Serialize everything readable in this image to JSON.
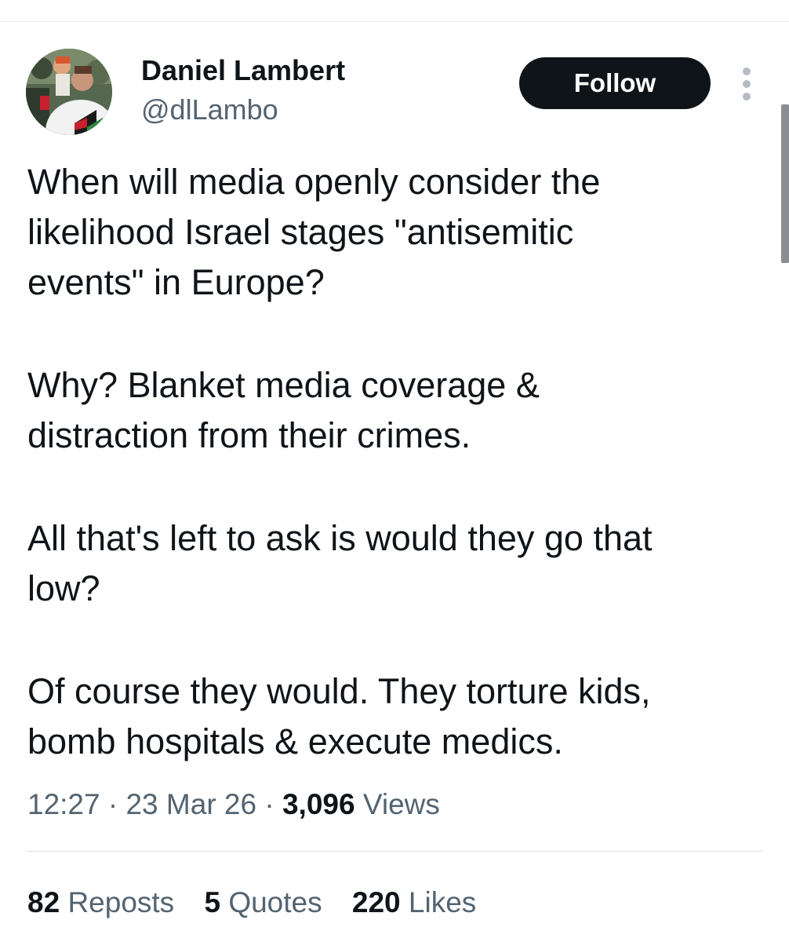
{
  "author": {
    "name": "Daniel Lambert",
    "handle": "@dlLambo"
  },
  "follow_button": {
    "label": "Follow"
  },
  "tweet": {
    "paragraphs": [
      "When will media openly consider the\nlikelihood Israel stages \"antisemitic\nevents\" in Europe?",
      "Why? Blanket media coverage &\ndistraction from their crimes.",
      "All that's left to ask is would they go that\nlow?",
      "Of course they would. They torture kids,\nbomb hospitals & execute medics."
    ]
  },
  "meta": {
    "time": "12:27",
    "separator": "·",
    "date": "23 Mar 26",
    "views_count": "3,096",
    "views_label": "Views"
  },
  "stats": {
    "reposts": {
      "count": "82",
      "label": "Reposts"
    },
    "quotes": {
      "count": "5",
      "label": "Quotes"
    },
    "likes": {
      "count": "220",
      "label": "Likes"
    }
  },
  "icons": {
    "more": "more-vertical-icon"
  },
  "colors": {
    "text_primary": "#0f1419",
    "text_secondary": "#536471",
    "follow_bg": "#0f1419",
    "divider": "#dfe3e6"
  }
}
